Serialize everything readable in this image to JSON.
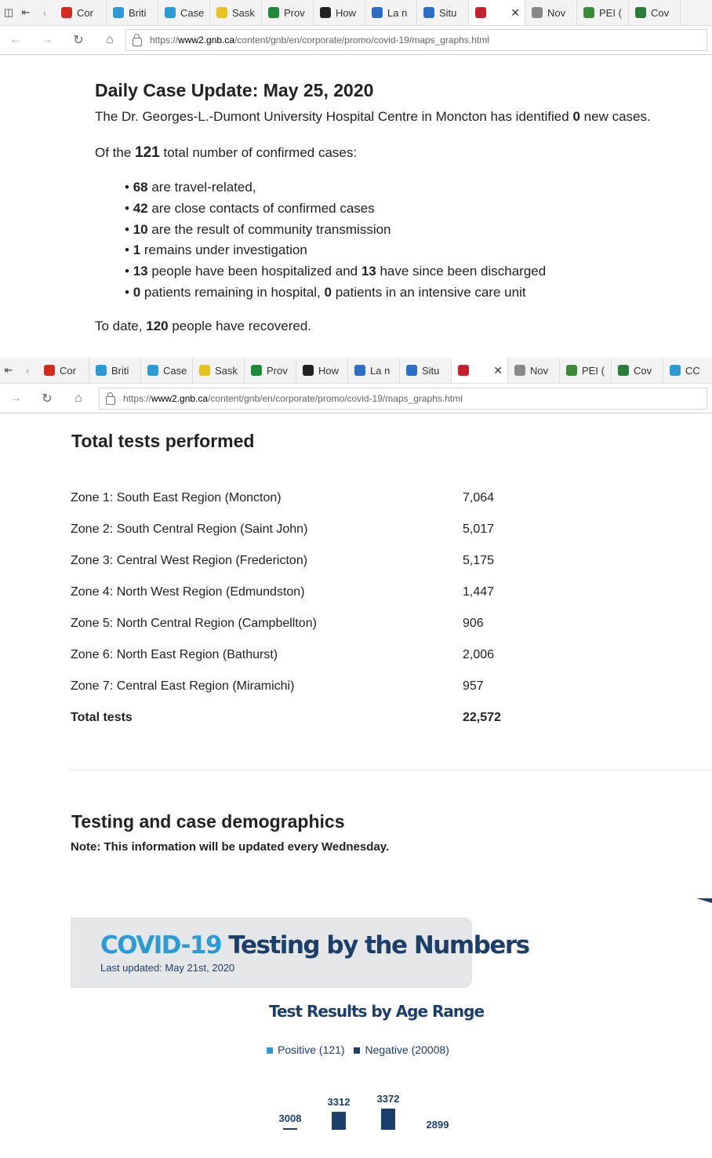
{
  "browser": {
    "tabs": [
      "Cor",
      "Briti",
      "Case",
      "Sask",
      "Prov",
      "How",
      "La n",
      "Situ",
      "",
      "Nov",
      "PEI (",
      "Cov"
    ],
    "tabs2": [
      "Cor",
      "Briti",
      "Case",
      "Sask",
      "Prov",
      "How",
      "La n",
      "Situ",
      "",
      "Nov",
      "PEI (",
      "Cov",
      "CC"
    ],
    "url_prefix": "https://",
    "url_host": "www2.gnb.ca",
    "url_path": "/content/gnb/en/corporate/promo/covid-19/maps_graphs.html"
  },
  "daily": {
    "title": "Daily Case Update: May 25, 2020",
    "hospital_pre": "The Dr. Georges-L.-Dumont University Hospital Centre in Moncton has identified",
    "hospital_num": "0",
    "hospital_post": "new cases.",
    "total_pre": "Of the",
    "total_num": "121",
    "total_post": "total number of confirmed cases:",
    "bullets": [
      {
        "a": "68",
        "t1": " are travel-related,"
      },
      {
        "a": "42",
        "t1": " are close contacts of confirmed cases"
      },
      {
        "a": "10",
        "t1": " are the result of community transmission"
      },
      {
        "a": "1",
        "t1": " remains under investigation"
      },
      {
        "a": "13",
        "t1": " people have been hospitalized and ",
        "b": "13",
        "t2": " have since been discharged"
      },
      {
        "a": "0",
        "t1": " patients remaining in hospital, ",
        "b": "0",
        "t2": " patients in an intensive care unit"
      }
    ],
    "recovered_pre": "To date,",
    "recovered_num": "120",
    "recovered_post": "people have recovered."
  },
  "tests": {
    "title": "Total tests performed",
    "rows": [
      {
        "zone": "Zone 1: South East Region (Moncton)",
        "value": "7,064"
      },
      {
        "zone": "Zone 2: South Central Region (Saint John)",
        "value": "5,017"
      },
      {
        "zone": "Zone 3: Central West Region (Fredericton)",
        "value": "5,175"
      },
      {
        "zone": "Zone 4: North West Region (Edmundston)",
        "value": "1,447"
      },
      {
        "zone": "Zone 5: North Central Region (Campbellton)",
        "value": "906"
      },
      {
        "zone": "Zone 6: North East Region (Bathurst)",
        "value": "2,006"
      },
      {
        "zone": "Zone 7: Central East Region (Miramichi)",
        "value": "957"
      }
    ],
    "total_label": "Total tests",
    "total_value": "22,572"
  },
  "demographics": {
    "title": "Testing and case demographics",
    "note": "Note: This information will be updated every Wednesday."
  },
  "infographic": {
    "title_covid": "COVID-19",
    "title_rest": " Testing by the Numbers",
    "updated": "Last updated: May 21st, 2020",
    "subtitle": "Test Results by Age Range"
  },
  "chart_data": {
    "type": "bar",
    "title": "Test Results by Age Range",
    "series": [
      {
        "name": "Positive (121)",
        "color": "#2a9bd5"
      },
      {
        "name": "Negative (20008)",
        "color": "#1b3f6a",
        "values": [
          3008,
          3312,
          3372,
          2899
        ]
      }
    ],
    "colors": {
      "positive": "#2a9bd5",
      "negative": "#1b3f6a"
    }
  }
}
